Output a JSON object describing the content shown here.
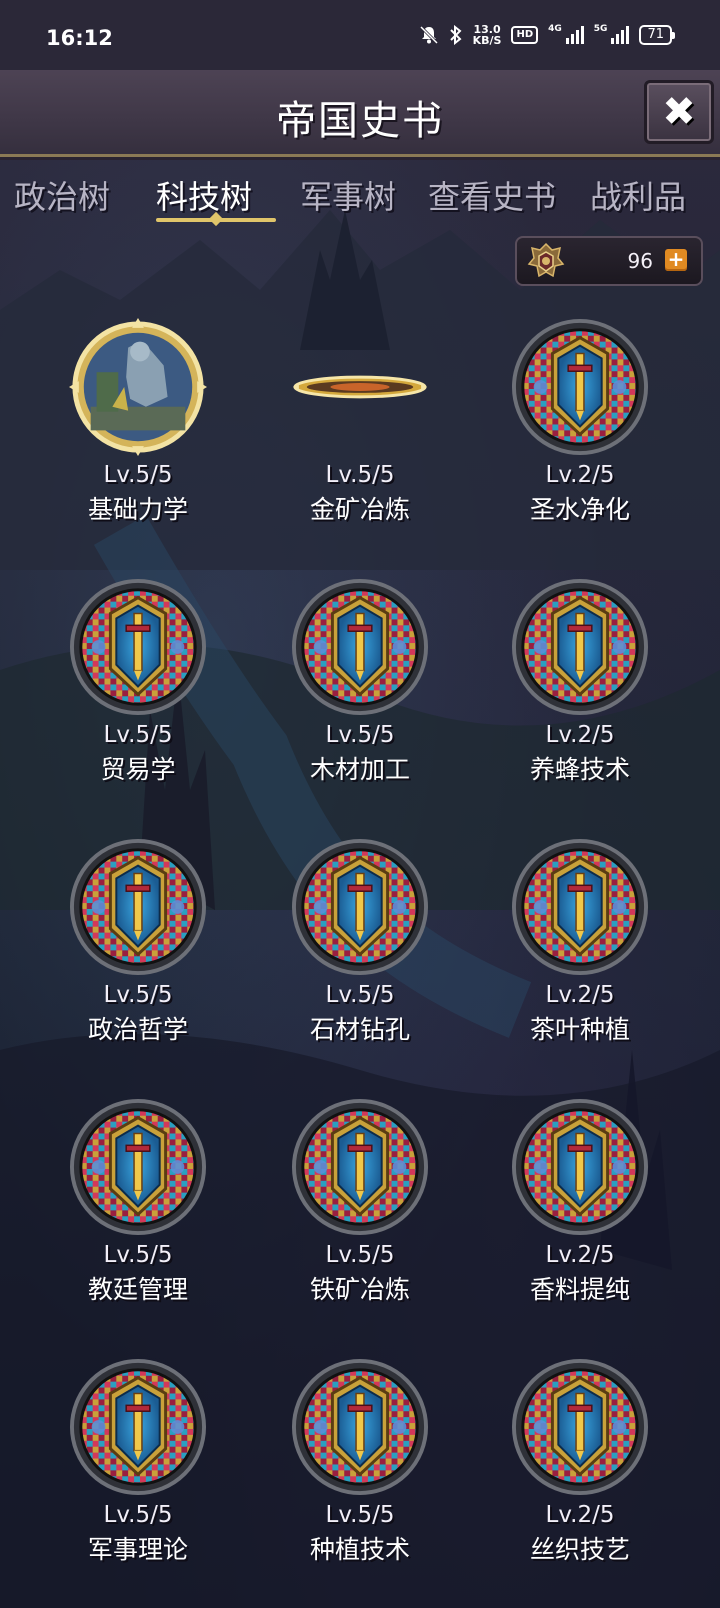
{
  "status_bar": {
    "time": "16:12",
    "net_speed_value": "13.0",
    "net_speed_unit": "KB/S",
    "hd_label": "HD",
    "network_1": "4G",
    "network_2": "5G",
    "battery": "71"
  },
  "header": {
    "title": "帝国史书",
    "close_icon": "close-x-icon"
  },
  "tabs": [
    {
      "label": "政治树",
      "active": false
    },
    {
      "label": "科技树",
      "active": true
    },
    {
      "label": "军事树",
      "active": false
    },
    {
      "label": "查看史书",
      "active": false
    },
    {
      "label": "战利品",
      "active": false
    }
  ],
  "currency": {
    "value": "96",
    "icon": "imperial-emblem-icon",
    "add_icon": "plus-icon"
  },
  "colors": {
    "gold_accent": "#e0c56a",
    "plus_orange": "#e08a22",
    "header_bg": "#3f3747"
  },
  "technologies": [
    {
      "level": "Lv.5/5",
      "name": "基础力学",
      "icon": "statue-medallion-icon"
    },
    {
      "level": "Lv.5/5",
      "name": "金矿冶炼",
      "icon": "gold-ring-disc-icon"
    },
    {
      "level": "Lv.2/5",
      "name": "圣水净化",
      "icon": "stained-glass-sword-icon"
    },
    {
      "level": "Lv.5/5",
      "name": "贸易学",
      "icon": "stained-glass-sword-icon"
    },
    {
      "level": "Lv.5/5",
      "name": "木材加工",
      "icon": "stained-glass-sword-icon"
    },
    {
      "level": "Lv.2/5",
      "name": "养蜂技术",
      "icon": "stained-glass-sword-icon"
    },
    {
      "level": "Lv.5/5",
      "name": "政治哲学",
      "icon": "stained-glass-sword-icon"
    },
    {
      "level": "Lv.5/5",
      "name": "石材钻孔",
      "icon": "stained-glass-sword-icon"
    },
    {
      "level": "Lv.2/5",
      "name": "茶叶种植",
      "icon": "stained-glass-sword-icon"
    },
    {
      "level": "Lv.5/5",
      "name": "教廷管理",
      "icon": "stained-glass-sword-icon"
    },
    {
      "level": "Lv.5/5",
      "name": "铁矿冶炼",
      "icon": "stained-glass-sword-icon"
    },
    {
      "level": "Lv.2/5",
      "name": "香料提纯",
      "icon": "stained-glass-sword-icon"
    },
    {
      "level": "Lv.5/5",
      "name": "军事理论",
      "icon": "stained-glass-sword-icon"
    },
    {
      "level": "Lv.5/5",
      "name": "种植技术",
      "icon": "stained-glass-sword-icon"
    },
    {
      "level": "Lv.2/5",
      "name": "丝织技艺",
      "icon": "stained-glass-sword-icon"
    }
  ]
}
